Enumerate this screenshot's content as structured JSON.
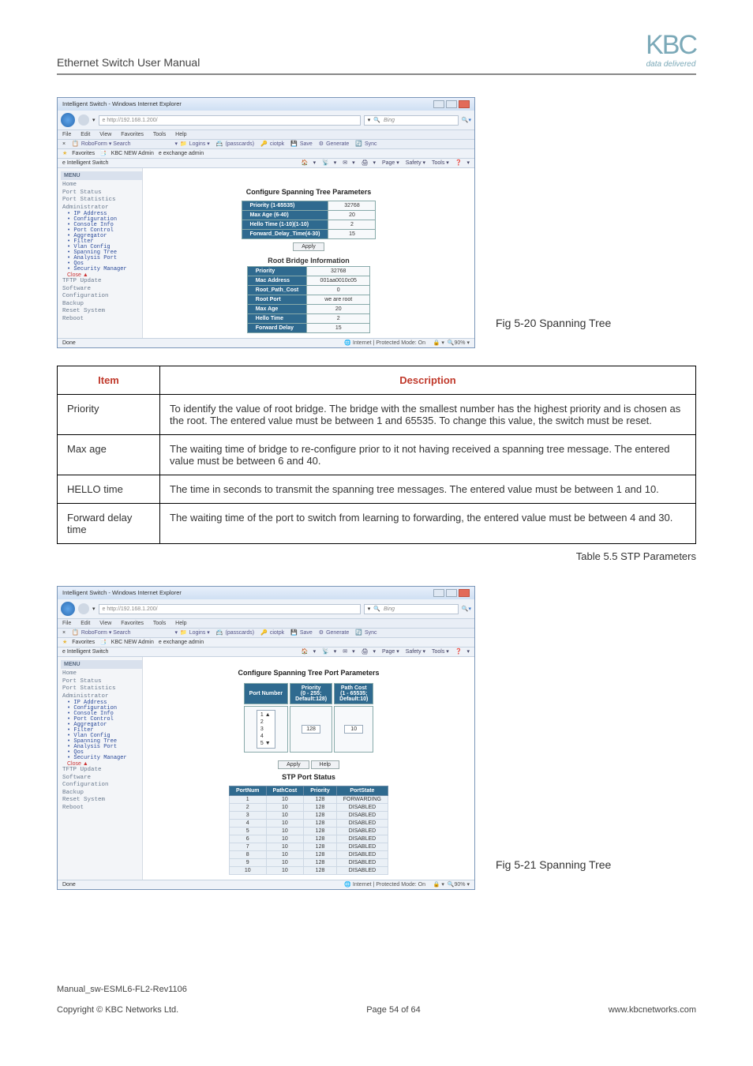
{
  "doc": {
    "title": "Ethernet Switch User Manual",
    "logo_tag": "data delivered",
    "manual_ref": "Manual_sw-ESML6-FL2-Rev1106",
    "copyright": "Copyright © KBC Networks Ltd.",
    "page_label": "Page 54 of 64",
    "site": "www.kbcnetworks.com"
  },
  "ie_common": {
    "window_title": "Intelligent Switch - Windows Internet Explorer",
    "address": "http://192.168.1.200/",
    "bing": "Bing",
    "menu": {
      "file": "File",
      "edit": "Edit",
      "view": "View",
      "favorites": "Favorites",
      "tools": "Tools",
      "help": "Help"
    },
    "robo_search": "RoboForm ▾ Search",
    "robo_items": {
      "logins": "Logins ▾",
      "passcards": "(passcards)",
      "ciotpk": "ciotpk",
      "save": "Save",
      "generate": "Generate",
      "sync": "Sync"
    },
    "fav_label": "Favorites",
    "fav_item1": "KBC NEW Admin",
    "fav_item2": "exchange admin",
    "tab_title": "Intelligent Switch",
    "page_tools": {
      "home": "▾",
      "feeds": "▾",
      "mail": "▾",
      "print": "▾",
      "page": "Page ▾",
      "safety": "Safety ▾",
      "tools": "Tools ▾",
      "help": "▾"
    },
    "done": "Done",
    "zone": "Internet | Protected Mode: On",
    "zoom": "90%"
  },
  "side_menu": {
    "header": "MENU",
    "items0": [
      "Home",
      "Port Status",
      "Port Statistics",
      "Administrator"
    ],
    "items_admin": [
      "IP Address",
      "Configuration",
      "Console Info",
      "Port Control",
      "Aggregator",
      "Filter",
      "Vlan Config",
      "Spanning Tree",
      "Analysis Port",
      "Qos",
      "Security Manager"
    ],
    "close": "Close ▲",
    "items_after": [
      "TFTP Update",
      "Software",
      "Configuration",
      "Backup",
      "Reset System",
      "Reboot"
    ]
  },
  "fig1": {
    "caption": "Fig 5-20 Spanning Tree",
    "cfg_title": "Configure Spanning Tree Parameters",
    "priority_lbl": "Priority (1-65535)",
    "priority_val": "32768",
    "maxage_lbl": "Max Age (6-40)",
    "maxage_val": "20",
    "hello_lbl": "Hello Time (1-10)(1-10)",
    "hello_val": "2",
    "fwd_lbl": "Forward_Delay_Time(4-30)",
    "fwd_val": "15",
    "apply": "Apply",
    "rb_title": "Root Bridge Information",
    "rb_rows": [
      {
        "lbl": "Priority",
        "val": "32768"
      },
      {
        "lbl": "Mac Address",
        "val": "001aa0010c05"
      },
      {
        "lbl": "Root_Path_Cost",
        "val": "0"
      },
      {
        "lbl": "Root Port",
        "val": "we are root"
      },
      {
        "lbl": "Max Age",
        "val": "20"
      },
      {
        "lbl": "Hello Time",
        "val": "2"
      },
      {
        "lbl": "Forward Delay",
        "val": "15"
      }
    ]
  },
  "stp_table": {
    "item_hdr": "Item",
    "desc_hdr": "Description",
    "rows": [
      {
        "item": "Priority",
        "desc": "To identify the value of root bridge. The bridge with the smallest number has the highest priority and is chosen as the root. The entered value must be between 1 and 65535. To change this value, the switch must be reset."
      },
      {
        "item": "Max age",
        "desc": "The waiting time of bridge to re-configure prior to it not having received a spanning tree message. The entered value must be between 6 and 40."
      },
      {
        "item": "HELLO time",
        "desc": "The time in seconds to transmit the spanning tree messages. The entered value must be between 1 and 10."
      },
      {
        "item": "Forward delay time",
        "desc": "The waiting time of the port to switch from learning to forwarding, the entered value must be between 4 and 30."
      }
    ],
    "caption": "Table 5.5 STP Parameters"
  },
  "fig2": {
    "caption": "Fig 5-21 Spanning Tree",
    "cfg_title": "Configure Spanning Tree Port Parameters",
    "port_hdr": "Port Number",
    "prio_hdr": "Priority\n(0 - 255;\nDefault:128)",
    "cost_hdr": "Path Cost\n(1 - 65535;\nDefault:10)",
    "port_sel_vals": [
      "1 ▲",
      "2",
      "3",
      "4",
      "5 ▼"
    ],
    "prio_val": "128",
    "cost_val": "10",
    "apply": "Apply",
    "help": "Help",
    "status_title": "STP Port Status",
    "status_headers": [
      "PortNum",
      "PathCost",
      "Priority",
      "PortState"
    ],
    "status_rows": [
      [
        "1",
        "10",
        "128",
        "FORWARDING"
      ],
      [
        "2",
        "10",
        "128",
        "DISABLED"
      ],
      [
        "3",
        "10",
        "128",
        "DISABLED"
      ],
      [
        "4",
        "10",
        "128",
        "DISABLED"
      ],
      [
        "5",
        "10",
        "128",
        "DISABLED"
      ],
      [
        "6",
        "10",
        "128",
        "DISABLED"
      ],
      [
        "7",
        "10",
        "128",
        "DISABLED"
      ],
      [
        "8",
        "10",
        "128",
        "DISABLED"
      ],
      [
        "9",
        "10",
        "128",
        "DISABLED"
      ],
      [
        "10",
        "10",
        "128",
        "DISABLED"
      ]
    ]
  }
}
